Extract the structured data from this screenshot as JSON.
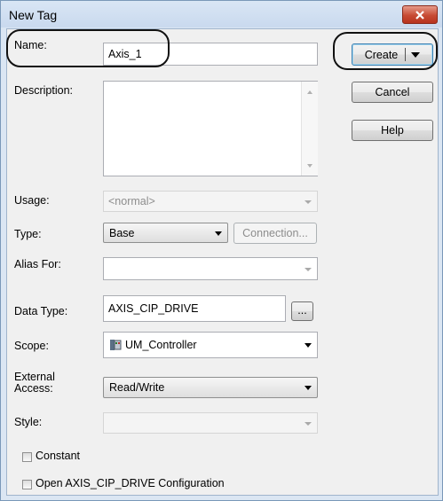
{
  "window": {
    "title": "New Tag"
  },
  "fields": {
    "name": {
      "label": "Name:",
      "value": "Axis_1"
    },
    "description": {
      "label": "Description:",
      "value": ""
    },
    "usage": {
      "label": "Usage:",
      "value": "<normal>"
    },
    "type": {
      "label": "Type:",
      "value": "Base",
      "connection_button": "Connection..."
    },
    "alias_for": {
      "label": "Alias For:",
      "value": ""
    },
    "data_type": {
      "label": "Data Type:",
      "value": "AXIS_CIP_DRIVE",
      "browse_button": "..."
    },
    "scope": {
      "label": "Scope:",
      "value": "UM_Controller",
      "icon": "controller-icon"
    },
    "external_access": {
      "label_line1": "External",
      "label_line2": "Access:",
      "value": "Read/Write"
    },
    "style": {
      "label": "Style:",
      "value": ""
    }
  },
  "checkboxes": {
    "constant": {
      "label": "Constant",
      "checked": false
    },
    "open_config": {
      "label": "Open AXIS_CIP_DRIVE Configuration",
      "checked": false
    }
  },
  "buttons": {
    "create": "Create",
    "cancel": "Cancel",
    "help": "Help"
  },
  "colors": {
    "close_button": "#c74b34",
    "highlight_oval": "#111111",
    "dialog_background": "#f0f0f0"
  }
}
